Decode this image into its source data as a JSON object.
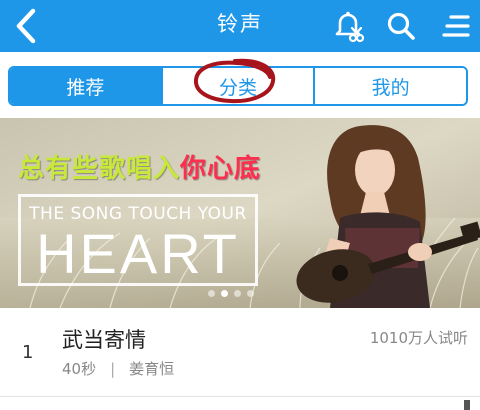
{
  "header": {
    "title": "铃声",
    "back_icon": "chevron-left-icon",
    "actions": [
      "bell-scissors-icon",
      "search-icon",
      "menu-icon"
    ],
    "background": "#1e97e8"
  },
  "tabs": {
    "items": [
      {
        "label": "推荐",
        "active": true
      },
      {
        "label": "分类",
        "active": false
      },
      {
        "label": "我的",
        "active": false
      }
    ],
    "accent": "#1e97e8",
    "annotation_color": "#a8141c"
  },
  "banner": {
    "slogan_part1": "总有些歌唱入",
    "slogan_part2": "你心底",
    "headline_small": "THE SONG TOUCH YOUR",
    "headline_big": "HEART",
    "pager": {
      "count": 4,
      "active_index": 1
    }
  },
  "list": [
    {
      "rank": "1",
      "title": "武当寄情",
      "duration": "40秒",
      "separator": "|",
      "artist": "姜育恒",
      "listens": "1010万人试听"
    }
  ]
}
